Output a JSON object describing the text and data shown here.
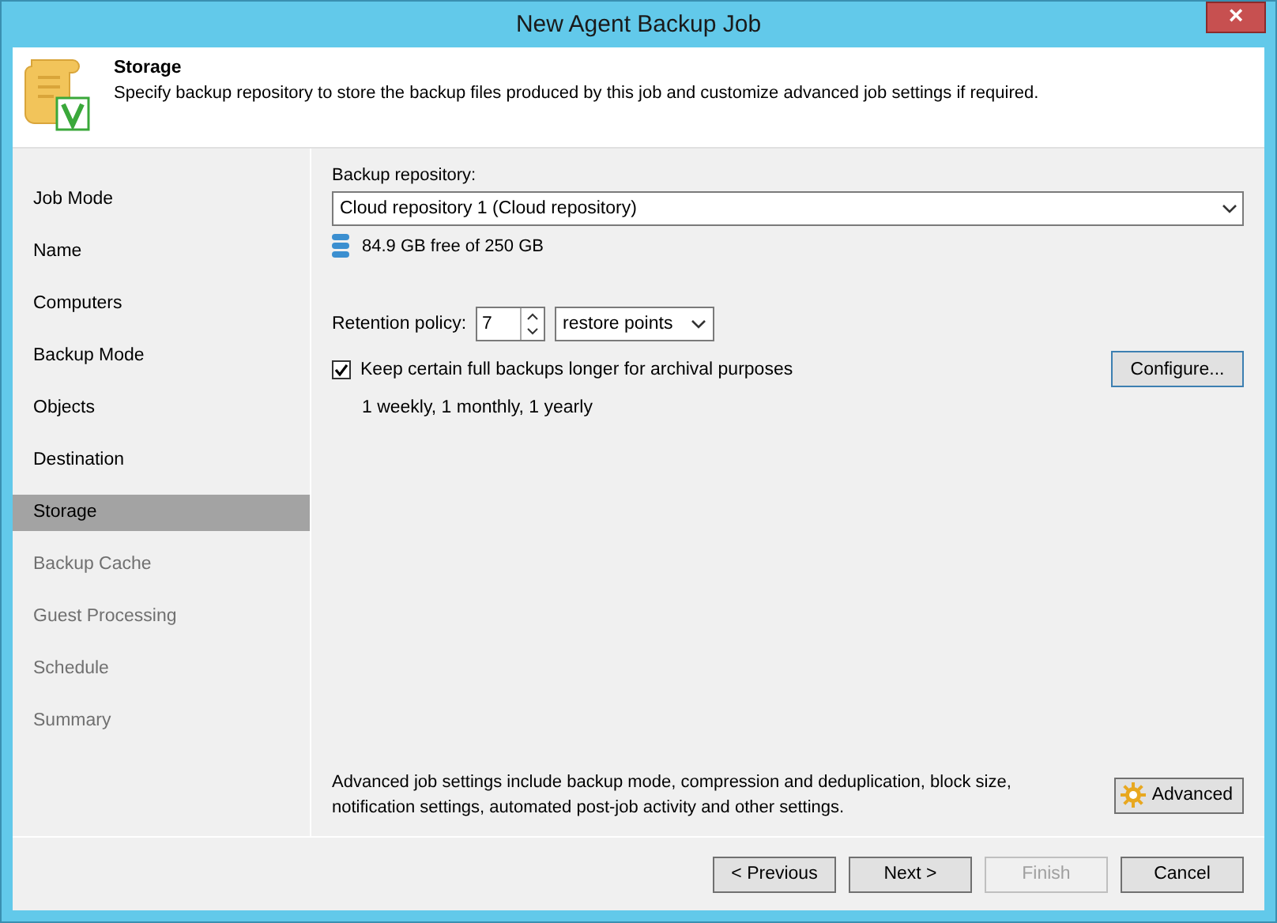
{
  "window": {
    "title": "New Agent Backup Job",
    "close": "×"
  },
  "header": {
    "title": "Storage",
    "description": "Specify backup repository to store the backup files produced by this job and customize advanced job settings if required."
  },
  "sidebar": {
    "items": [
      {
        "label": "Job Mode",
        "selected": false,
        "disabled": false
      },
      {
        "label": "Name",
        "selected": false,
        "disabled": false
      },
      {
        "label": "Computers",
        "selected": false,
        "disabled": false
      },
      {
        "label": "Backup Mode",
        "selected": false,
        "disabled": false
      },
      {
        "label": "Objects",
        "selected": false,
        "disabled": false
      },
      {
        "label": "Destination",
        "selected": false,
        "disabled": false
      },
      {
        "label": "Storage",
        "selected": true,
        "disabled": false
      },
      {
        "label": "Backup Cache",
        "selected": false,
        "disabled": true
      },
      {
        "label": "Guest Processing",
        "selected": false,
        "disabled": true
      },
      {
        "label": "Schedule",
        "selected": false,
        "disabled": true
      },
      {
        "label": "Summary",
        "selected": false,
        "disabled": true
      }
    ]
  },
  "repository": {
    "label": "Backup repository:",
    "value": "Cloud repository 1 (Cloud repository)",
    "free_space": "84.9 GB free of 250 GB"
  },
  "retention": {
    "label": "Retention policy:",
    "value": "7",
    "unit": "restore points"
  },
  "archival": {
    "label": "Keep certain full backups longer for archival purposes",
    "checked": true,
    "summary": "1 weekly, 1 monthly, 1 yearly",
    "button": "Configure..."
  },
  "advanced": {
    "text": "Advanced job settings include backup mode, compression and deduplication, block size, notification settings, automated post-job activity and other settings.",
    "button": "Advanced"
  },
  "buttons": [
    {
      "label": "< Previous",
      "disabled": false
    },
    {
      "label": "Next >",
      "disabled": false
    },
    {
      "label": "Finish",
      "disabled": true
    },
    {
      "label": "Cancel",
      "disabled": false
    }
  ]
}
